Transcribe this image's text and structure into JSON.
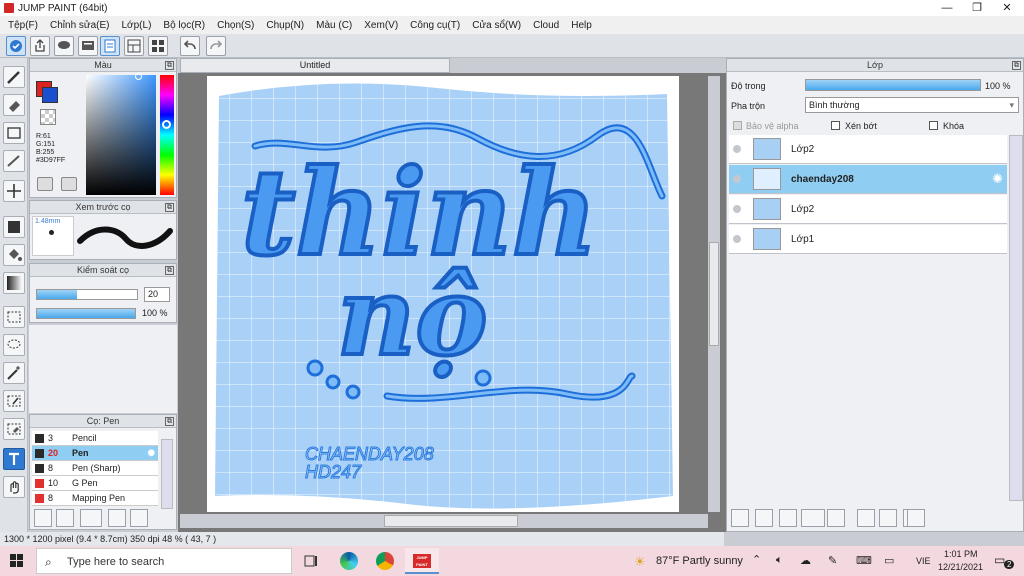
{
  "window": {
    "title": "JUMP PAINT (64bit)",
    "min": "—",
    "max": "❐",
    "close": "✕"
  },
  "menu": [
    "Tệp(F)",
    "Chỉnh sửa(E)",
    "Lớp(L)",
    "Bộ lọc(R)",
    "Chọn(S)",
    "Chụp(N)",
    "Màu (C)",
    "Xem(V)",
    "Công cụ(T)",
    "Cửa sổ(W)",
    "Cloud",
    "Help"
  ],
  "color_panel": {
    "title": "Màu",
    "r": "R:61",
    "g": "G:151",
    "b": "B:255",
    "hex": "#3D97FF",
    "fg_color": "#3D97FF"
  },
  "brush_preview": {
    "title": "Xem trước cọ",
    "size": "1.48mm"
  },
  "brush_control": {
    "title": "Kiểm soát cọ",
    "size_value": "20",
    "opacity_value": "100 %",
    "size_fraction": 0.4,
    "opacity_fraction": 1.0
  },
  "brush_list": {
    "title": "Cọ: Pen",
    "items": [
      {
        "size": "3",
        "name": "Pencil",
        "color": "#2a2a2a"
      },
      {
        "size": "20",
        "name": "Pen",
        "color": "#2a2a2a"
      },
      {
        "size": "8",
        "name": "Pen (Sharp)",
        "color": "#2a2a2a"
      },
      {
        "size": "10",
        "name": "G Pen",
        "color": "#e03030"
      },
      {
        "size": "8",
        "name": "Mapping Pen",
        "color": "#e03030"
      }
    ]
  },
  "document": {
    "tab": "Untitled",
    "art_line1": "thinh",
    "art_line2": "nộ",
    "signature1": "CHAENDAY208",
    "signature2": "HD247"
  },
  "layer_panel": {
    "title": "Lớp",
    "opacity_label": "Độ trong",
    "opacity_value": "100 %",
    "opacity_fraction": 1.0,
    "blend_label": "Pha trộn",
    "blend_value": "Bình thường",
    "protect_alpha": "Bảo vệ alpha",
    "clip": "Xén bớt",
    "lock": "Khóa",
    "layers": [
      {
        "name": "Lớp2"
      },
      {
        "name": "chaenday208"
      },
      {
        "name": "Lớp2"
      },
      {
        "name": "Lớp1"
      }
    ]
  },
  "status": {
    "text": "1300 * 1200 pixel   (9.4 * 8.7cm)   350 dpi   48 %   ( 43, 7 )"
  },
  "taskbar": {
    "search_placeholder": "Type here to search",
    "weather": "87°F  Partly sunny",
    "lang": "VIE",
    "time": "1:01 PM",
    "date": "12/21/2021",
    "notif_count": "2",
    "app_badge": "JUMP PAINT"
  },
  "colors": {
    "accent": "#2f79d0",
    "selection": "#8fcdf2",
    "ink": "#1e6fd9"
  }
}
